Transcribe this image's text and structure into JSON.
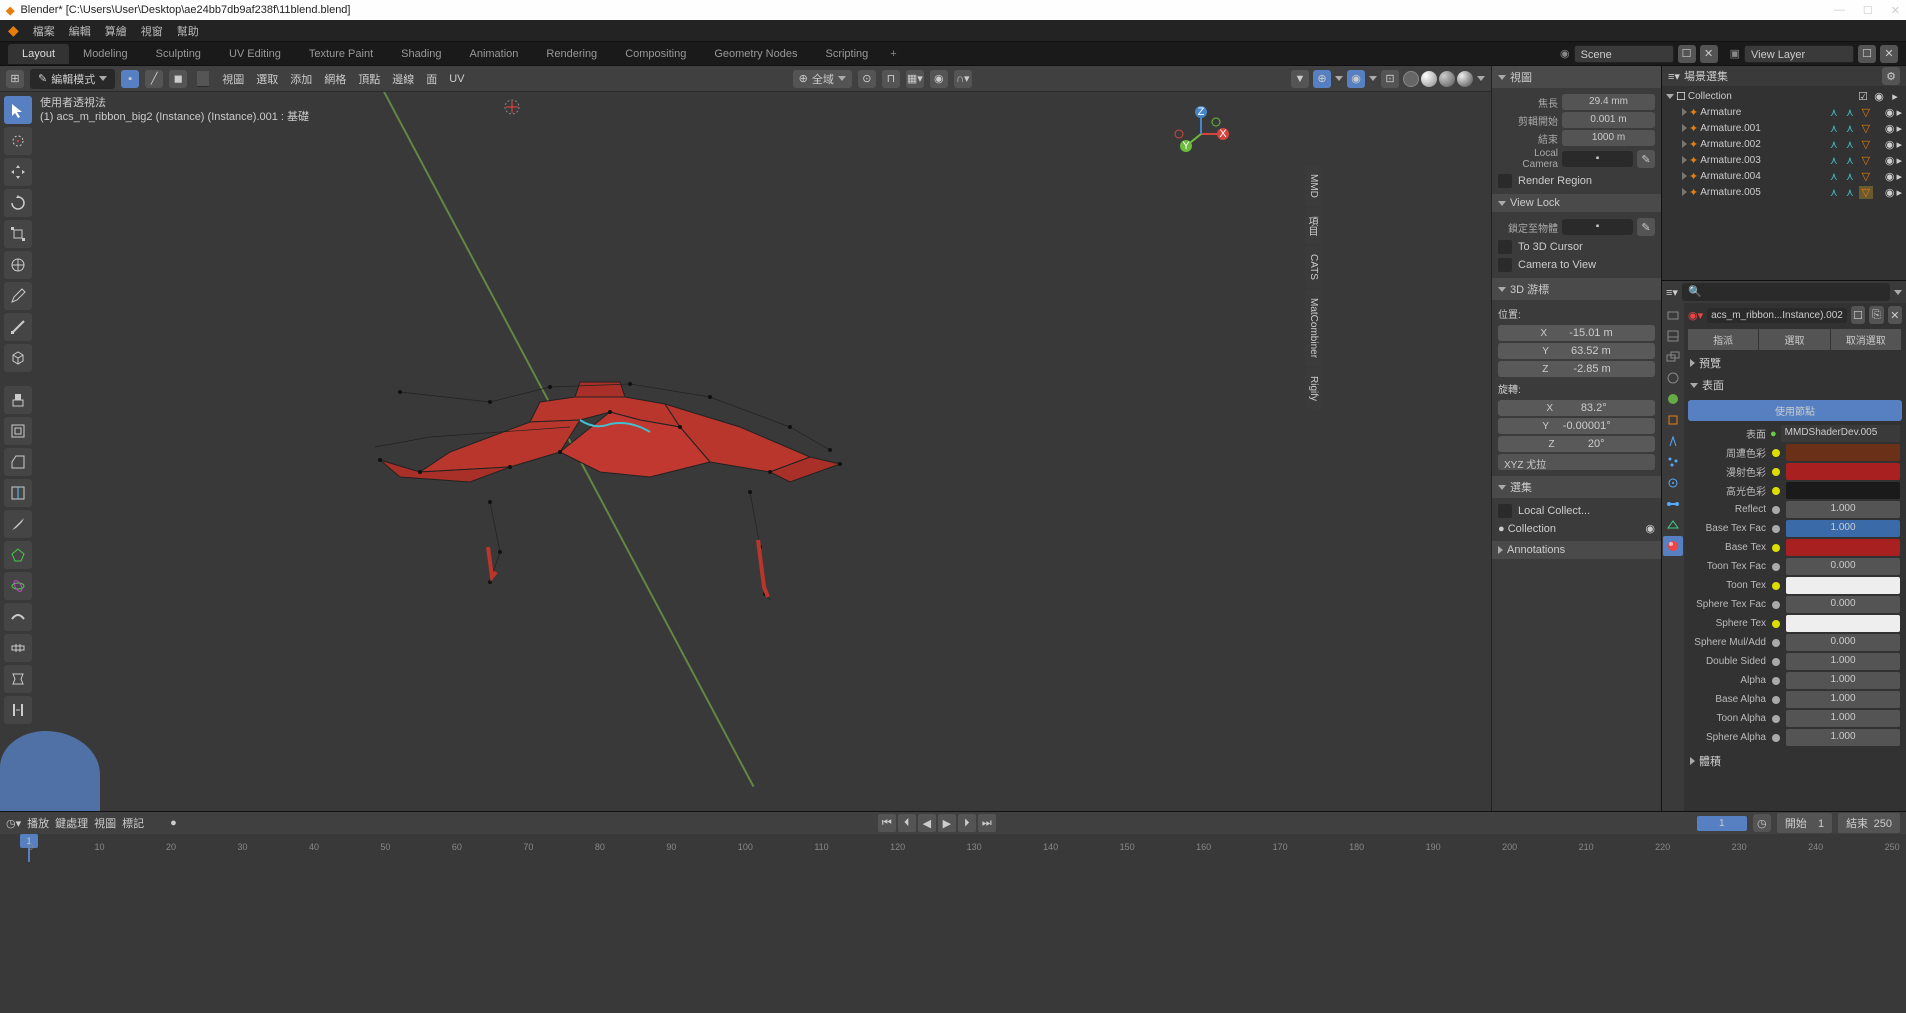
{
  "titlebar": {
    "title": "Blender* [C:\\Users\\User\\Desktop\\ae24bb7db9af238f\\11blend.blend]"
  },
  "topmenu": {
    "items": [
      "檔案",
      "編輯",
      "算繪",
      "視窗",
      "幫助"
    ]
  },
  "tabs": {
    "list": [
      "Layout",
      "Modeling",
      "Sculpting",
      "UV Editing",
      "Texture Paint",
      "Shading",
      "Animation",
      "Rendering",
      "Compositing",
      "Geometry Nodes",
      "Scripting"
    ],
    "active": 0,
    "scene_label": "Scene",
    "viewlayer_label": "View Layer"
  },
  "vp_header": {
    "mode": "編輯模式",
    "menus": [
      "視圖",
      "選取",
      "添加",
      "網格",
      "頂點",
      "邊線",
      "面",
      "UV"
    ],
    "global": "全域"
  },
  "vp_info": {
    "line1": "使用者透視法",
    "line2": "(1) acs_m_ribbon_big2 (Instance) (Instance).001 : 基礎"
  },
  "npanel": {
    "view": {
      "header": "視圖",
      "focal_label": "焦長",
      "focal": "29.4 mm",
      "clip_start_label": "剪輯開始",
      "clip_start": "0.001 m",
      "clip_end_label": "結束",
      "clip_end": "1000 m",
      "localcam_label": "Local Camera",
      "render_region": "Render Region"
    },
    "viewlock": {
      "header": "View Lock",
      "lockto_label": "鎖定至物體",
      "to3d": "To 3D Cursor",
      "camtoview": "Camera to View"
    },
    "cursor": {
      "header": "3D 游標",
      "pos_label": "位置:",
      "x": "-15.01 m",
      "y": "63.52 m",
      "z": "-2.85 m",
      "rot_label": "旋轉:",
      "rx": "83.2°",
      "ry": "-0.00001°",
      "rz": "20°",
      "euler": "XYZ 尤拉"
    },
    "selection": {
      "header": "選集",
      "localcollect": "Local Collect...",
      "collection": "Collection"
    },
    "annotations": {
      "header": "Annotations"
    },
    "tabs": [
      "MMD",
      "項目",
      "CATS",
      "MatCombiner",
      "Rigify"
    ]
  },
  "outliner": {
    "header": "場景選集",
    "collection": "Collection",
    "items": [
      {
        "name": "Armature",
        "highlighted": false
      },
      {
        "name": "Armature.001",
        "highlighted": false
      },
      {
        "name": "Armature.002",
        "highlighted": false
      },
      {
        "name": "Armature.003",
        "highlighted": false
      },
      {
        "name": "Armature.004",
        "highlighted": false
      },
      {
        "name": "Armature.005",
        "highlighted": true
      }
    ]
  },
  "properties": {
    "breadcrumb": "acs_m_ribbon...Instance).002",
    "buttons": {
      "inherit": "指派",
      "select": "選取",
      "deselect": "取消選取"
    },
    "preview_hdr": "預覽",
    "surface_hdr": "表面",
    "use_nodes": "使用節點",
    "surface_label": "表面",
    "shader_name": "MMDShaderDev.005",
    "params": [
      {
        "label": "周遭色彩",
        "type": "color",
        "val": "brown"
      },
      {
        "label": "漫射色彩",
        "type": "color",
        "val": "red"
      },
      {
        "label": "高光色彩",
        "type": "color",
        "val": "dark"
      },
      {
        "label": "Reflect",
        "type": "num",
        "val": "1.000"
      },
      {
        "label": "Base Tex Fac",
        "type": "num",
        "val": "1.000",
        "blue": true
      },
      {
        "label": "Base Tex",
        "type": "color",
        "val": "red"
      },
      {
        "label": "Toon Tex Fac",
        "type": "num",
        "val": "0.000"
      },
      {
        "label": "Toon Tex",
        "type": "color",
        "val": "white"
      },
      {
        "label": "Sphere Tex Fac",
        "type": "num",
        "val": "0.000"
      },
      {
        "label": "Sphere Tex",
        "type": "color",
        "val": "white"
      },
      {
        "label": "Sphere Mul/Add",
        "type": "num",
        "val": "0.000"
      },
      {
        "label": "Double Sided",
        "type": "num",
        "val": "1.000"
      },
      {
        "label": "Alpha",
        "type": "num",
        "val": "1.000"
      },
      {
        "label": "Base Alpha",
        "type": "num",
        "val": "1.000"
      },
      {
        "label": "Toon Alpha",
        "type": "num",
        "val": "1.000"
      },
      {
        "label": "Sphere Alpha",
        "type": "num",
        "val": "1.000"
      }
    ],
    "volume_hdr": "體積"
  },
  "timeline": {
    "menus": [
      "播放",
      "鍵處理",
      "視圖",
      "標記"
    ],
    "current": "1",
    "start_label": "開始",
    "start": "1",
    "end_label": "結束",
    "end": "250",
    "ticks": [
      "0",
      "10",
      "20",
      "30",
      "40",
      "50",
      "60",
      "70",
      "80",
      "90",
      "100",
      "110",
      "120",
      "130",
      "140",
      "150",
      "160",
      "170",
      "180",
      "190",
      "200",
      "210",
      "220",
      "230",
      "240",
      "250"
    ]
  }
}
